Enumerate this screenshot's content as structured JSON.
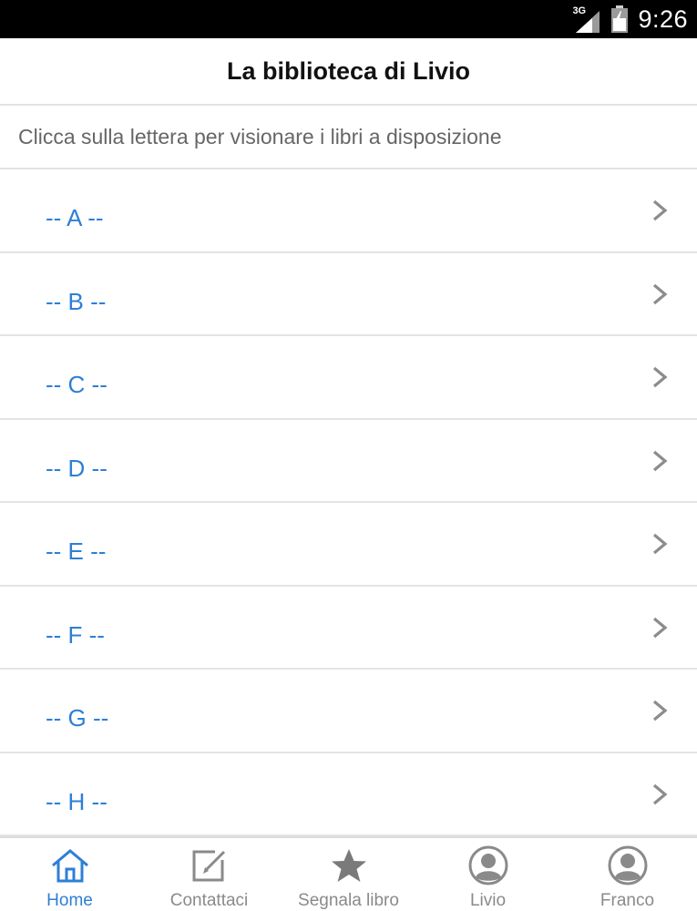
{
  "status_bar": {
    "network": "3G",
    "time": "9:26"
  },
  "header": {
    "title": "La biblioteca di Livio"
  },
  "subtitle": "Clicca sulla lettera per visionare i libri a disposizione",
  "letters": [
    {
      "label": "-- A --"
    },
    {
      "label": "-- B --"
    },
    {
      "label": "-- C --"
    },
    {
      "label": "-- D --"
    },
    {
      "label": "-- E --"
    },
    {
      "label": "-- F --"
    },
    {
      "label": "-- G --"
    },
    {
      "label": "-- H --"
    }
  ],
  "tabs": [
    {
      "label": "Home",
      "icon": "home-icon",
      "active": true
    },
    {
      "label": "Contattaci",
      "icon": "edit-icon",
      "active": false
    },
    {
      "label": "Segnala libro",
      "icon": "star-icon",
      "active": false
    },
    {
      "label": "Livio",
      "icon": "user-icon",
      "active": false
    },
    {
      "label": "Franco",
      "icon": "user-icon",
      "active": false
    }
  ],
  "colors": {
    "accent": "#2d7fd6",
    "inactive": "#8a8a8a",
    "status_bar": "#000000"
  }
}
